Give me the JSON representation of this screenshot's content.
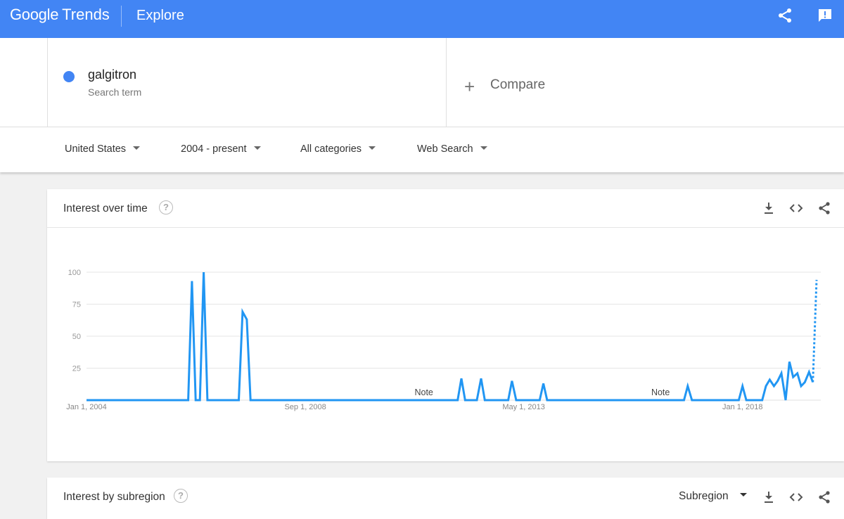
{
  "header": {
    "logo_google": "Google",
    "logo_trends": "Trends",
    "section": "Explore",
    "share_icon": "share-icon",
    "feedback_icon": "feedback-icon"
  },
  "search": {
    "term": "galgitron",
    "term_type": "Search term",
    "term_color": "#4285f4",
    "compare_symbol": "+",
    "compare_label": "Compare"
  },
  "filters": {
    "region": "United States",
    "time": "2004 - present",
    "category": "All categories",
    "property": "Web Search"
  },
  "interest_over_time": {
    "title": "Interest over time",
    "help": "?",
    "actions": [
      "download-icon",
      "embed-icon",
      "share-icon"
    ]
  },
  "interest_by_subregion": {
    "title": "Interest by subregion",
    "help": "?",
    "select_value": "Subregion",
    "actions": [
      "download-icon",
      "embed-icon",
      "share-icon"
    ]
  },
  "chart_data": {
    "type": "line",
    "y_ticks": [
      25,
      50,
      75,
      100
    ],
    "ylim": [
      0,
      100
    ],
    "x_ticks": [
      {
        "label": "Jan 1, 2004",
        "t": 2004.0
      },
      {
        "label": "Sep 1, 2008",
        "t": 2008.67
      },
      {
        "label": "May 1, 2013",
        "t": 2013.33
      },
      {
        "label": "Jan 1, 2018",
        "t": 2018.0
      }
    ],
    "xlim": [
      2004.0,
      2019.67
    ],
    "grid": true,
    "series_color": "#2196f3",
    "series": [
      {
        "points": [
          [
            2004.0,
            0
          ],
          [
            2006.17,
            0
          ],
          [
            2006.25,
            93
          ],
          [
            2006.33,
            0
          ],
          [
            2006.42,
            0
          ],
          [
            2006.5,
            100
          ],
          [
            2006.58,
            0
          ],
          [
            2007.25,
            0
          ],
          [
            2007.33,
            69
          ],
          [
            2007.42,
            63
          ],
          [
            2007.5,
            0
          ],
          [
            2011.92,
            0
          ],
          [
            2012.0,
            17
          ],
          [
            2012.08,
            0
          ],
          [
            2012.33,
            0
          ],
          [
            2012.42,
            17
          ],
          [
            2012.5,
            0
          ],
          [
            2013.0,
            0
          ],
          [
            2013.08,
            15
          ],
          [
            2013.17,
            0
          ],
          [
            2013.67,
            0
          ],
          [
            2013.75,
            13
          ],
          [
            2013.83,
            0
          ],
          [
            2016.75,
            0
          ],
          [
            2016.83,
            11
          ],
          [
            2016.92,
            0
          ],
          [
            2017.92,
            0
          ],
          [
            2018.0,
            11
          ],
          [
            2018.08,
            0
          ],
          [
            2018.42,
            0
          ],
          [
            2018.5,
            11
          ],
          [
            2018.58,
            16
          ],
          [
            2018.67,
            11
          ],
          [
            2018.75,
            15
          ],
          [
            2018.83,
            21
          ],
          [
            2018.92,
            0
          ],
          [
            2019.0,
            30
          ],
          [
            2019.08,
            18
          ],
          [
            2019.17,
            21
          ],
          [
            2019.25,
            11
          ],
          [
            2019.33,
            14
          ],
          [
            2019.42,
            22
          ],
          [
            2019.5,
            14
          ]
        ],
        "partial_points": [
          [
            2019.5,
            14
          ],
          [
            2019.58,
            94
          ]
        ]
      }
    ],
    "annotations": [
      {
        "label": "Note",
        "t": 2011.2
      },
      {
        "label": "Note",
        "t": 2016.25
      }
    ]
  }
}
